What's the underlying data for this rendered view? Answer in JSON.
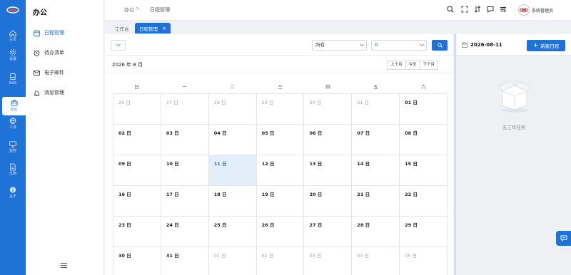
{
  "brand": {
    "accent": "#1f72d6",
    "today_bg": "#e3eefb"
  },
  "rail": {
    "items": [
      {
        "label": "主页",
        "icon": "home-icon"
      },
      {
        "label": "设置",
        "icon": "gear-icon"
      },
      {
        "label": "NAS",
        "icon": "nas-icon"
      },
      {
        "label": "办公",
        "icon": "briefcase-icon",
        "active": true
      },
      {
        "label": "工具",
        "icon": "globe-icon"
      },
      {
        "label": "监控",
        "icon": "monitor-icon"
      },
      {
        "label": "文档",
        "icon": "document-icon"
      },
      {
        "label": "关于",
        "icon": "info-icon"
      }
    ]
  },
  "sidebar": {
    "title": "办公",
    "items": [
      {
        "label": "日程管理",
        "icon": "calendar-icon",
        "active": true
      },
      {
        "label": "待办清单",
        "icon": "alarm-clock-icon"
      },
      {
        "label": "电子邮件",
        "icon": "mail-icon"
      },
      {
        "label": "消息管理",
        "icon": "bell-icon"
      }
    ]
  },
  "header": {
    "breadcrumb": [
      "办公",
      "日程管理"
    ],
    "user_name": "系统管理员"
  },
  "tabs": {
    "home": "工作台",
    "active": "日程管理",
    "close": "×"
  },
  "filters": {
    "status_value": "所有",
    "count_value": "0"
  },
  "calendar": {
    "month_title": "2026 年 8 月",
    "nav": {
      "prev": "上个月",
      "today": "今天",
      "next": "下个月"
    },
    "weekdays": [
      "日",
      "一",
      "二",
      "三",
      "四",
      "五",
      "六"
    ],
    "weeks": [
      [
        [
          "26 日",
          1
        ],
        [
          "27 日",
          1
        ],
        [
          "28 日",
          1
        ],
        [
          "29 日",
          1
        ],
        [
          "30 日",
          1
        ],
        [
          "31 日",
          1
        ],
        [
          "01 日",
          0
        ]
      ],
      [
        [
          "02 日",
          0
        ],
        [
          "03 日",
          0
        ],
        [
          "04 日",
          0
        ],
        [
          "05 日",
          0
        ],
        [
          "06 日",
          0
        ],
        [
          "07 日",
          0
        ],
        [
          "08 日",
          0
        ]
      ],
      [
        [
          "09 日",
          0
        ],
        [
          "10 日",
          0
        ],
        [
          "11 日",
          2
        ],
        [
          "12 日",
          0
        ],
        [
          "13 日",
          0
        ],
        [
          "14 日",
          0
        ],
        [
          "15 日",
          0
        ]
      ],
      [
        [
          "16 日",
          0
        ],
        [
          "17 日",
          0
        ],
        [
          "18 日",
          0
        ],
        [
          "19 日",
          0
        ],
        [
          "20 日",
          0
        ],
        [
          "21 日",
          0
        ],
        [
          "22 日",
          0
        ]
      ],
      [
        [
          "23 日",
          0
        ],
        [
          "24 日",
          0
        ],
        [
          "25 日",
          0
        ],
        [
          "26 日",
          0
        ],
        [
          "27 日",
          0
        ],
        [
          "28 日",
          0
        ],
        [
          "29 日",
          0
        ]
      ],
      [
        [
          "30 日",
          0
        ],
        [
          "31 日",
          0
        ],
        [
          "01 日",
          1
        ],
        [
          "02 日",
          1
        ],
        [
          "03 日",
          1
        ],
        [
          "04 日",
          1
        ],
        [
          "05 日",
          1
        ]
      ]
    ]
  },
  "task_panel": {
    "date": "2026-08-11",
    "new_button": "新建日程",
    "empty_text": "无工作任务"
  }
}
